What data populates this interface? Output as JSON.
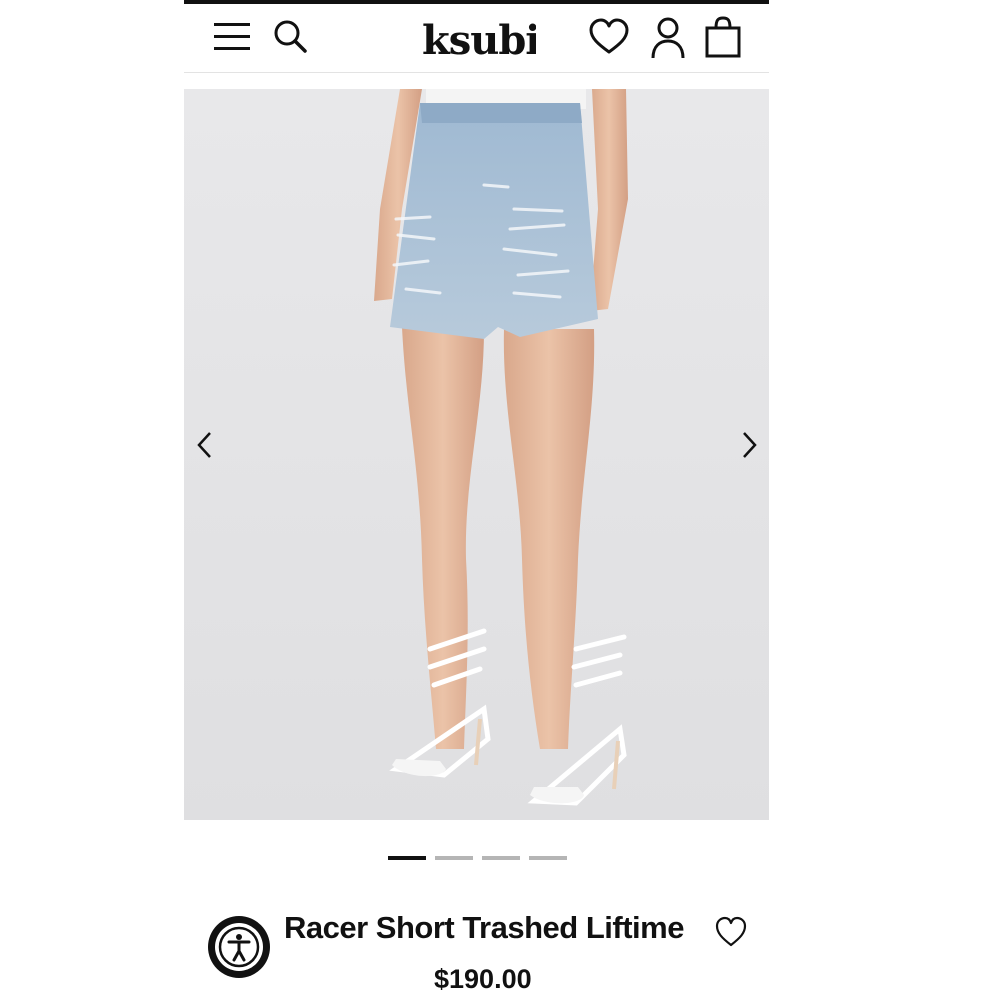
{
  "header": {
    "logo_text": "ksubi",
    "icons": [
      "menu-icon",
      "search-icon",
      "heart-icon",
      "account-icon",
      "bag-icon"
    ]
  },
  "carousel": {
    "slide_count": 4,
    "active_slide": 1,
    "prev_icon": "chevron-left-icon",
    "next_icon": "chevron-right-icon"
  },
  "product": {
    "title": "Racer Short Trashed Liftime",
    "price": "$190.00",
    "wishlist_icon": "heart-outline-icon"
  },
  "accessibility": {
    "icon": "accessibility-icon"
  },
  "colors": {
    "text": "#111111",
    "image_bg": "#e6e6e8",
    "dot_inactive": "#b5b5b5",
    "dot_active": "#111111"
  }
}
